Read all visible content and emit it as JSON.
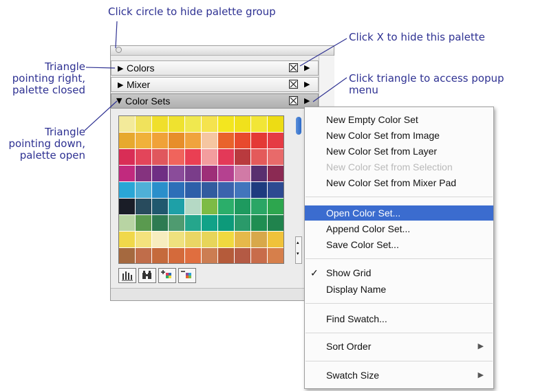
{
  "callouts": {
    "hide_group": "Click circle to hide palette group",
    "hide_palette": "Click X to hide this palette",
    "popup_menu": "Click triangle to access popup menu",
    "tri_right": [
      "Triangle",
      "pointing right,",
      "palette closed"
    ],
    "tri_down": [
      "Triangle",
      "pointing down,",
      "palette open"
    ]
  },
  "palette": {
    "sections": [
      {
        "label": "Colors",
        "state": "closed",
        "triangle": "▶"
      },
      {
        "label": "Mixer",
        "state": "closed",
        "triangle": "▶"
      },
      {
        "label": "Color Sets",
        "state": "open",
        "triangle": "▼"
      }
    ],
    "menu_triangle": "▶",
    "swatch_colors": [
      [
        "#f3ea9a",
        "#f0e25c",
        "#f0df2b",
        "#efe22f",
        "#f0e84f",
        "#f5e34e",
        "#f3e61f",
        "#f0e11c",
        "#f2e637",
        "#eddc14"
      ],
      [
        "#e7a92e",
        "#f0b13a",
        "#f0a238",
        "#e78e2a",
        "#f0a33d",
        "#f5c6a1",
        "#e9632b",
        "#e84a2d",
        "#e43935",
        "#e53b44"
      ],
      [
        "#d92d56",
        "#e3455a",
        "#e0575d",
        "#f0645c",
        "#ea3f53",
        "#f39d9e",
        "#e33958",
        "#b93a3e",
        "#e45a5a",
        "#e86a6a"
      ],
      [
        "#c12a7e",
        "#85337f",
        "#6f2e84",
        "#8a4c9a",
        "#7a3d8a",
        "#9e2f78",
        "#b54190",
        "#d17aa6",
        "#592f6f",
        "#8b2a53"
      ],
      [
        "#2aa6d6",
        "#4fb0d7",
        "#2a8fcb",
        "#2d6fb8",
        "#2d5fa9",
        "#325c9f",
        "#3b63ad",
        "#4275bc",
        "#1e3c7f",
        "#2d4a91"
      ],
      [
        "#1a1d27",
        "#284b5d",
        "#20586e",
        "#1ea0a7",
        "#b5d9c5",
        "#7dbb45",
        "#2bae6a",
        "#1e9a5f",
        "#2aa665",
        "#2da64e"
      ],
      [
        "#b8d4a3",
        "#5a9a4f",
        "#2e7b52",
        "#4f9b70",
        "#25a68c",
        "#11a288",
        "#0d9a7a",
        "#2a9a6a",
        "#1f8e52",
        "#20834d"
      ],
      [
        "#f0d84a",
        "#f4e27d",
        "#f7edbf",
        "#efe17e",
        "#ead664",
        "#e7d55a",
        "#f0d93f",
        "#e6b94a",
        "#d8a84a",
        "#f0c23a"
      ],
      [
        "#a5693f",
        "#c06d4a",
        "#c56a3c",
        "#d46a3b",
        "#e06e3f",
        "#cc7d52",
        "#b55b3a",
        "#b45a44",
        "#c86c4a",
        "#d67f4b"
      ]
    ],
    "toolbar_icons": [
      "swatch-library-icon",
      "find-swatch-icon",
      "add-swatch-icon",
      "remove-swatch-icon"
    ],
    "scroll_up": "▴",
    "scroll_down": "▾"
  },
  "menu": {
    "items": [
      {
        "label": "New Empty Color Set",
        "enabled": true
      },
      {
        "label": "New Color Set from Image",
        "enabled": true
      },
      {
        "label": "New Color Set from Layer",
        "enabled": true
      },
      {
        "label": "New Color Set from Selection",
        "enabled": false
      },
      {
        "label": "New Color Set from Mixer Pad",
        "enabled": true
      },
      {
        "label": "Open Color Set...",
        "enabled": true,
        "selected": true
      },
      {
        "label": "Append Color Set...",
        "enabled": true
      },
      {
        "label": "Save Color Set...",
        "enabled": true
      },
      {
        "label": "Show Grid",
        "enabled": true,
        "checked": true
      },
      {
        "label": "Display Name",
        "enabled": true
      },
      {
        "label": "Find Swatch...",
        "enabled": true
      },
      {
        "label": "Sort Order",
        "enabled": true,
        "submenu": true
      },
      {
        "label": "Swatch Size",
        "enabled": true,
        "submenu": true
      }
    ],
    "check_mark": "✓",
    "submenu_arrow": "▶"
  },
  "colors": {
    "callout_text": "#2e3192",
    "selection_highlight": "#3b6ccf"
  }
}
